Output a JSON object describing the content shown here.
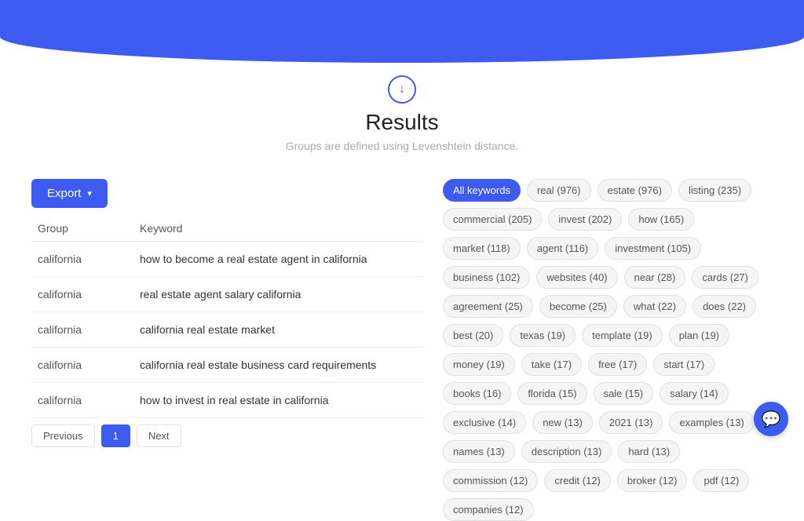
{
  "header": {
    "background_color": "#3d5af1"
  },
  "results": {
    "title": "Results",
    "subtitle": "Groups are defined using Levenshtein distance.",
    "down_arrow": "↓"
  },
  "toolbar": {
    "export_label": "Export",
    "export_icon": "▾"
  },
  "table": {
    "col_group": "Group",
    "col_keyword": "Keyword",
    "rows": [
      {
        "group": "california",
        "keyword": "how to become a real estate agent in california"
      },
      {
        "group": "california",
        "keyword": "real estate agent salary california"
      },
      {
        "group": "california",
        "keyword": "california real estate market"
      },
      {
        "group": "california",
        "keyword": "california real estate business card requirements"
      },
      {
        "group": "california",
        "keyword": "how to invest in real estate in california"
      }
    ]
  },
  "pagination": {
    "prev_label": "Previous",
    "next_label": "Next",
    "current_page": "1"
  },
  "keywords": {
    "tags": [
      {
        "label": "All keywords",
        "active": true
      },
      {
        "label": "real (976)",
        "active": false
      },
      {
        "label": "estate (976)",
        "active": false
      },
      {
        "label": "listing (235)",
        "active": false
      },
      {
        "label": "commercial (205)",
        "active": false
      },
      {
        "label": "invest (202)",
        "active": false
      },
      {
        "label": "how (165)",
        "active": false
      },
      {
        "label": "market (118)",
        "active": false
      },
      {
        "label": "agent (116)",
        "active": false
      },
      {
        "label": "investment (105)",
        "active": false
      },
      {
        "label": "business (102)",
        "active": false
      },
      {
        "label": "websites (40)",
        "active": false
      },
      {
        "label": "near (28)",
        "active": false
      },
      {
        "label": "cards (27)",
        "active": false
      },
      {
        "label": "agreement (25)",
        "active": false
      },
      {
        "label": "become (25)",
        "active": false
      },
      {
        "label": "what (22)",
        "active": false
      },
      {
        "label": "does (22)",
        "active": false
      },
      {
        "label": "best (20)",
        "active": false
      },
      {
        "label": "texas (19)",
        "active": false
      },
      {
        "label": "template (19)",
        "active": false
      },
      {
        "label": "plan (19)",
        "active": false
      },
      {
        "label": "money (19)",
        "active": false
      },
      {
        "label": "take (17)",
        "active": false
      },
      {
        "label": "free (17)",
        "active": false
      },
      {
        "label": "start (17)",
        "active": false
      },
      {
        "label": "books (16)",
        "active": false
      },
      {
        "label": "florida (15)",
        "active": false
      },
      {
        "label": "sale (15)",
        "active": false
      },
      {
        "label": "salary (14)",
        "active": false
      },
      {
        "label": "exclusive (14)",
        "active": false
      },
      {
        "label": "new (13)",
        "active": false
      },
      {
        "label": "2021 (13)",
        "active": false
      },
      {
        "label": "examples (13)",
        "active": false
      },
      {
        "label": "names (13)",
        "active": false
      },
      {
        "label": "description (13)",
        "active": false
      },
      {
        "label": "hard (13)",
        "active": false
      },
      {
        "label": "commission (12)",
        "active": false
      },
      {
        "label": "credit (12)",
        "active": false
      },
      {
        "label": "broker (12)",
        "active": false
      },
      {
        "label": "pdf (12)",
        "active": false
      },
      {
        "label": "companies (12)",
        "active": false
      }
    ]
  },
  "chat": {
    "icon": "💬"
  }
}
